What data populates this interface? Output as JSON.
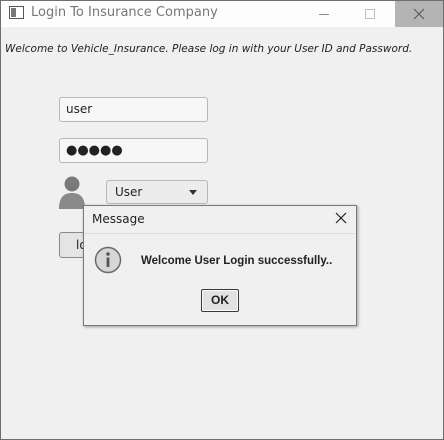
{
  "window": {
    "title": "Login To Insurance Company"
  },
  "welcome_text": "Welcome to  Vehicle_Insurance. Please log in with your User ID and Password.",
  "form": {
    "username_value": "user",
    "password_value": "●●●●●",
    "role_selected": "User",
    "login_label": "lo"
  },
  "dialog": {
    "title": "Message",
    "message": "Welcome  User Login  successfully..",
    "ok_label": "OK",
    "icon": "info-icon"
  },
  "icons": {
    "app": "app-icon",
    "avatar": "user-avatar-icon",
    "minimize": "minimize-icon",
    "maximize": "maximize-icon",
    "close": "close-icon"
  }
}
